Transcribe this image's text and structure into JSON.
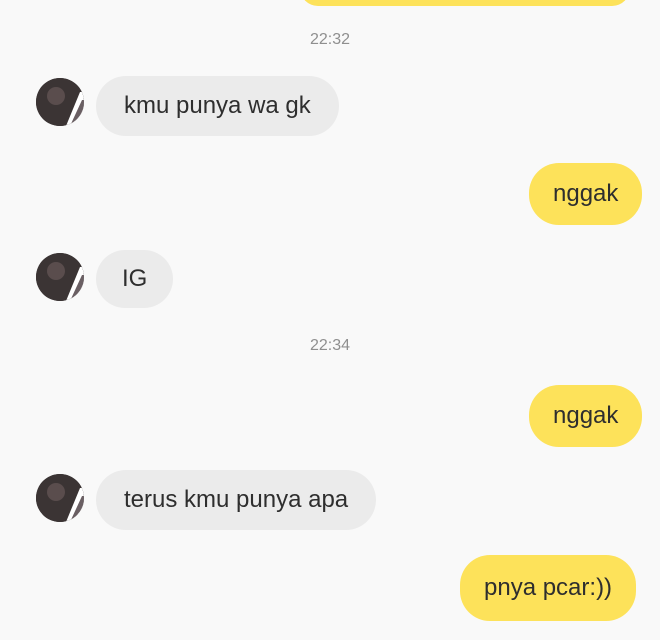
{
  "messages": [
    {
      "type": "timestamp",
      "text": "22:32"
    },
    {
      "type": "incoming",
      "text": "kmu punya wa gk"
    },
    {
      "type": "outgoing",
      "text": "nggak"
    },
    {
      "type": "incoming",
      "text": "IG"
    },
    {
      "type": "timestamp",
      "text": "22:34"
    },
    {
      "type": "outgoing",
      "text": "nggak"
    },
    {
      "type": "incoming",
      "text": "terus kmu punya apa"
    },
    {
      "type": "outgoing",
      "text": "pnya pcar:))"
    }
  ],
  "colors": {
    "outgoing_bubble": "#fde25a",
    "incoming_bubble": "#ebebeb",
    "background": "#f9f9f9",
    "timestamp": "#8f8f8f",
    "text": "#2e2e2e"
  },
  "icons": {
    "avatar": "contact-avatar-icon"
  }
}
